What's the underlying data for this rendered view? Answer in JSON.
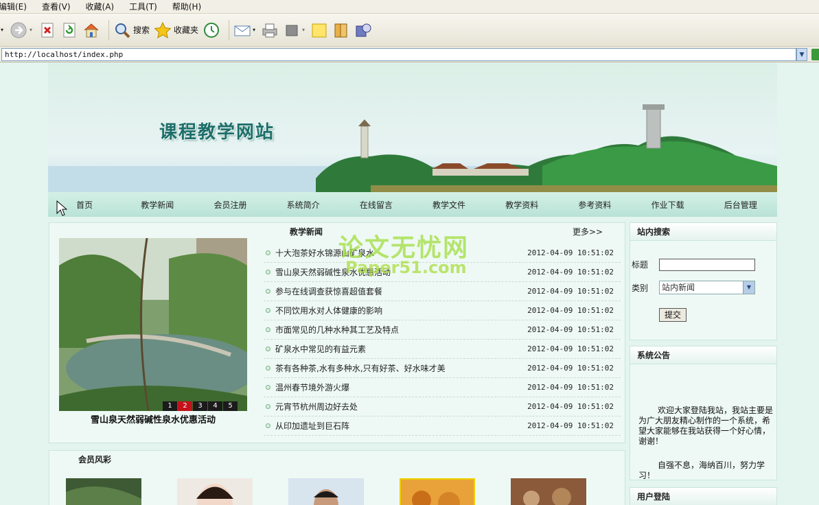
{
  "browser": {
    "menu": [
      "编辑(E)",
      "查看(V)",
      "收藏(A)",
      "工具(T)",
      "帮助(H)"
    ],
    "toolbar": {
      "search_label": "搜索",
      "favorites_label": "收藏夹"
    },
    "address": "http://localhost/index.php"
  },
  "site": {
    "title": "课程教学网站",
    "nav": [
      "首页",
      "教学新闻",
      "会员注册",
      "系统简介",
      "在线留言",
      "教学文件",
      "教学资料",
      "参考资料",
      "作业下载",
      "后台管理"
    ]
  },
  "news": {
    "heading": "教学新闻",
    "more": "更多>>",
    "featured_caption": "雪山泉天然弱碱性泉水优惠活动",
    "pager": [
      "1",
      "2",
      "3",
      "4",
      "5"
    ],
    "pager_active_index": 1,
    "items": [
      {
        "title": "十大泡茶好水锦源山矿泉水",
        "date": "2012-04-09 10:51:02"
      },
      {
        "title": "雪山泉天然弱碱性泉水优惠活动",
        "date": "2012-04-09 10:51:02"
      },
      {
        "title": "参与在线调查获惊喜超值套餐",
        "date": "2012-04-09 10:51:02"
      },
      {
        "title": "不同饮用水对人体健康的影响",
        "date": "2012-04-09 10:51:02"
      },
      {
        "title": "市面常见的几种水种其工艺及特点",
        "date": "2012-04-09 10:51:02"
      },
      {
        "title": "矿泉水中常见的有益元素",
        "date": "2012-04-09 10:51:02"
      },
      {
        "title": "茶有各种茶,水有多种水,只有好茶、好水味才美",
        "date": "2012-04-09 10:51:02"
      },
      {
        "title": "温州春节境外游火爆",
        "date": "2012-04-09 10:51:02"
      },
      {
        "title": "元宵节杭州周边好去处",
        "date": "2012-04-09 10:51:02"
      },
      {
        "title": "从印加遗址到巨石阵",
        "date": "2012-04-09 10:51:02"
      }
    ]
  },
  "watermark": {
    "line1": "论文无忧网",
    "line2": "Paper51.com"
  },
  "members": {
    "heading": "会员风彩"
  },
  "sidebar": {
    "search": {
      "heading": "站内搜索",
      "title_label": "标题",
      "title_value": "",
      "category_label": "类别",
      "category_value": "站内新闻",
      "submit_label": "提交"
    },
    "notice": {
      "heading": "系统公告",
      "text1": "欢迎大家登陆我站，我站主要是为广大朋友精心制作的一个系统，希望大家能够在我站获得一个好心情，谢谢！",
      "text2": "自强不息，海纳百川，努力学习！"
    },
    "login": {
      "heading": "用户登陆"
    }
  },
  "colors": {
    "page_bg": "#e4f4ee",
    "nav_bg": "#c6e9de",
    "pager_active": "#c4121b",
    "watermark": "#a6dc3c"
  }
}
